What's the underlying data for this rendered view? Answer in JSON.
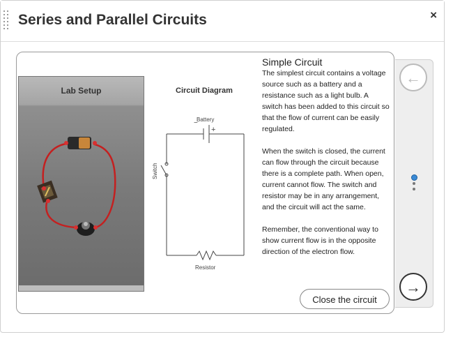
{
  "dialog": {
    "title": "Series and Parallel Circuits",
    "close_icon": "×"
  },
  "lab": {
    "title": "Lab Setup"
  },
  "diagram": {
    "title": "Circuit Diagram",
    "battery_label": "Battery",
    "switch_label": "Switch",
    "resistor_label": "Resistor",
    "battery_minus": "−",
    "battery_plus": "+"
  },
  "content": {
    "heading": "Simple Circuit",
    "paragraphs": [
      "The simplest circuit contains a voltage source such as a battery and a resistance such as a light bulb. A switch has been added to this circuit so that the flow of current can be easily regulated.",
      "When the switch is closed, the current can flow through the circuit because there is a complete path. When open, current cannot flow. The switch and resistor may be in any arrangement, and the circuit will act the same.",
      "Remember, the conventional way to show current flow is in the opposite direction of the electron flow."
    ],
    "action_label": "Close the circuit"
  },
  "navigation": {
    "prev_icon": "←",
    "next_icon": "→",
    "page_dots": 3,
    "active_dot": 1
  },
  "colors": {
    "wire": "#cc2222",
    "active_dot": "#3a8ad6"
  }
}
